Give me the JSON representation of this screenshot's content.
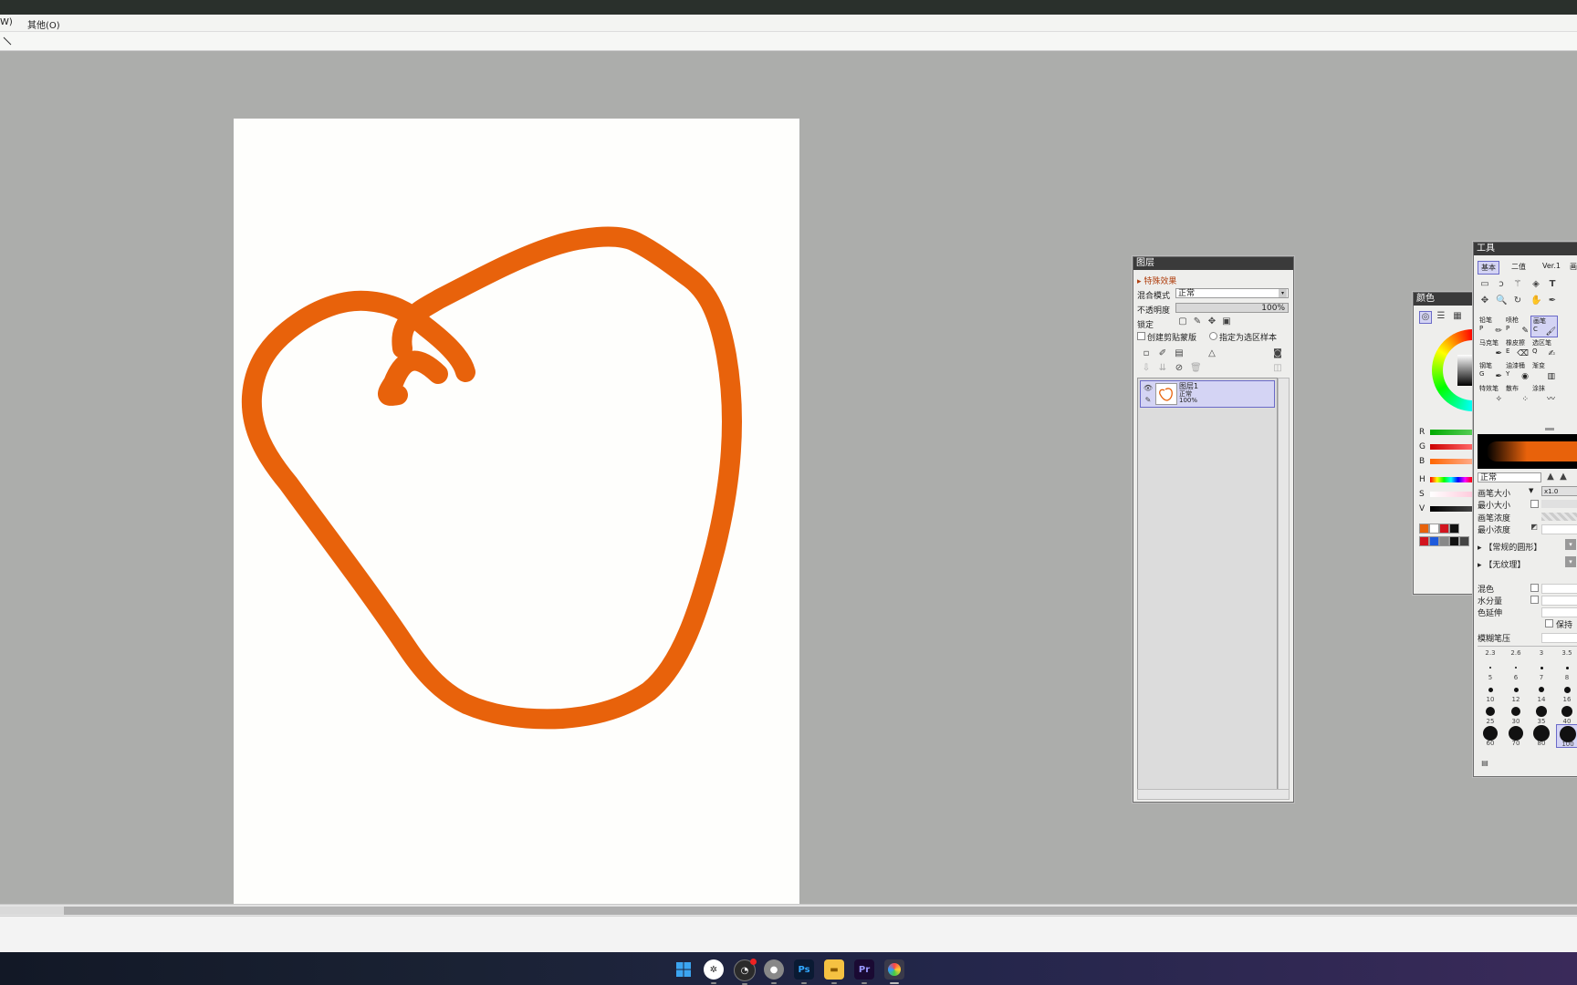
{
  "menu": {
    "partial_item": "W)",
    "other": "其他(O)"
  },
  "tool_options": {
    "icon": "line-tool-icon"
  },
  "stroke_color": "#e8620b",
  "layers_panel": {
    "title": "图层",
    "effects": "特殊效果",
    "blend_mode_label": "混合模式",
    "blend_mode_value": "正常",
    "opacity_label": "不透明度",
    "opacity_value": "100%",
    "lock_label": "锁定",
    "clipping_label": "创建剪贴蒙版",
    "selection_source_label": "指定为选区样本",
    "layer": {
      "name": "图层1",
      "mode": "正常",
      "opacity": "100%"
    }
  },
  "color_panel": {
    "title": "颜色",
    "channels": [
      "R",
      "G",
      "B",
      "H",
      "S",
      "V"
    ],
    "swatches": [
      "#e8620b",
      "#ffffff",
      "#d2141e",
      "#111111",
      "#d2141e",
      "#1e5adc",
      "#888888",
      "#111111",
      "#444444"
    ]
  },
  "tool_panel": {
    "title": "工具",
    "tabs": [
      "基本",
      "二值",
      "Ver.1",
      "画"
    ],
    "tools": [
      {
        "name": "铅笔",
        "key": "P"
      },
      {
        "name": "喷枪",
        "key": "P"
      },
      {
        "name": "画笔",
        "key": "C"
      },
      {
        "name": "马克笔",
        "key": ""
      },
      {
        "name": "橡皮擦",
        "key": "E"
      },
      {
        "name": "选区笔",
        "key": "Q"
      },
      {
        "name": "钢笔",
        "key": "G"
      },
      {
        "name": "油漆桶",
        "key": "Y"
      },
      {
        "name": "渐变",
        "key": ""
      },
      {
        "name": "特效笔",
        "key": ""
      },
      {
        "name": "散布",
        "key": ""
      },
      {
        "name": "涂抹",
        "key": ""
      }
    ],
    "brush_mode": "正常",
    "brush_size_label": "画笔大小",
    "brush_size_mult": "x1.0",
    "min_size_label": "最小大小",
    "density_label": "画笔浓度",
    "min_density_label": "最小浓度",
    "shape": "【常规的圆形】",
    "texture": "【无纹理】",
    "blend_label": "混色",
    "water_label": "水分量",
    "color_extend_label": "色延伸",
    "keep_label": "保持",
    "blur_pressure_label": "模糊笔压",
    "size_labels": [
      "2.3",
      "2.6",
      "3",
      "3.5",
      "5",
      "6",
      "7",
      "8",
      "10",
      "12",
      "14",
      "16",
      "25",
      "30",
      "35",
      "40",
      "60",
      "70",
      "80",
      "100"
    ]
  },
  "taskbar": {
    "icons": [
      "windows-start-icon",
      "app-icon",
      "obs-icon",
      "app-icon",
      "photoshop-icon",
      "file-explorer-icon",
      "premiere-icon",
      "paint-tool-sai-icon"
    ],
    "ps_label": "Ps",
    "pr_label": "Pr"
  }
}
